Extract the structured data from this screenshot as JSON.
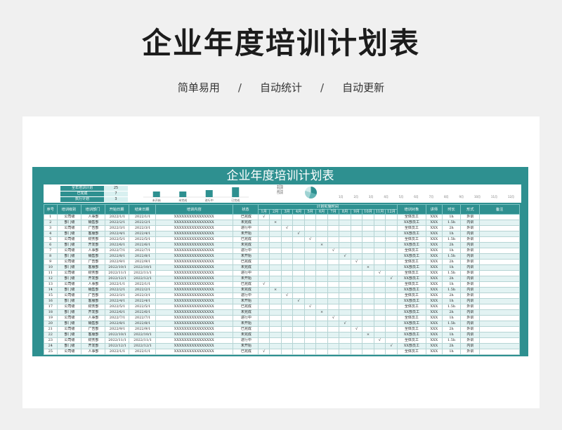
{
  "page": {
    "title": "企业年度培训计划表",
    "taglines": [
      "简单易用",
      "自动统计",
      "自动更新"
    ],
    "separator": "/"
  },
  "sheet": {
    "title": "企业年度培训计划表",
    "stats": [
      {
        "label": "全年培训计划",
        "value": "25"
      },
      {
        "label": "已完成",
        "value": "7"
      },
      {
        "label": "执行计划",
        "value": "3"
      }
    ],
    "mini_chart": {
      "categories": [
        "未开始",
        "未完成",
        "进行中",
        "已完成"
      ],
      "values": [
        4,
        4,
        5,
        7
      ]
    },
    "mini_pie_legend": [
      "未开始",
      "未完成",
      "进行中",
      "已完成"
    ],
    "mini_months": [
      "1月",
      "2月",
      "3月",
      "4月",
      "5月",
      "6月",
      "7月",
      "8月",
      "9月",
      "10月",
      "11月",
      "12月"
    ]
  },
  "table": {
    "headers": {
      "no": "序号",
      "level": "培训级别",
      "dept": "培训部门",
      "plan_date": "开始日期",
      "end_date": "结束日期",
      "content": "培训内容",
      "status": "状态",
      "plan_group": "计划实施时间",
      "target": "培训对象",
      "lecturer": "讲师",
      "hours": "时长",
      "mode": "形式",
      "note": "备注"
    },
    "months": [
      "1月",
      "2月",
      "3月",
      "4月",
      "5月",
      "6月",
      "7月",
      "8月",
      "9月",
      "10月",
      "11月",
      "12月"
    ],
    "rows": [
      {
        "no": "1",
        "level": "公司级",
        "dept": "人事部",
        "start": "2022/1/1",
        "end": "2022/1/1",
        "content": "XXXXXXXXXXXXXXXX",
        "status": "已完成",
        "month": 1,
        "mark": "√",
        "target": "全体员工",
        "lecturer": "XXX",
        "hours": "1h",
        "mode": "外训",
        "note": ""
      },
      {
        "no": "2",
        "level": "部门级",
        "dept": "销售部",
        "start": "2022/2/1",
        "end": "2022/2/1",
        "content": "XXXXXXXXXXXXXXXX",
        "status": "未完成",
        "month": 2,
        "mark": "×",
        "target": "XX部员工",
        "lecturer": "XXX",
        "hours": "1.5h",
        "mode": "内训",
        "note": ""
      },
      {
        "no": "3",
        "level": "公司级",
        "dept": "广告部",
        "start": "2022/3/1",
        "end": "2022/3/1",
        "content": "XXXXXXXXXXXXXXXX",
        "status": "进行中",
        "month": 3,
        "mark": "√",
        "target": "全体员工",
        "lecturer": "XXX",
        "hours": "2h",
        "mode": "外训",
        "note": ""
      },
      {
        "no": "4",
        "level": "部门级",
        "dept": "客服部",
        "start": "2022/4/1",
        "end": "2022/4/1",
        "content": "XXXXXXXXXXXXXXXX",
        "status": "未开始",
        "month": 4,
        "mark": "√",
        "target": "XX部员工",
        "lecturer": "XXX",
        "hours": "1h",
        "mode": "内训",
        "note": ""
      },
      {
        "no": "5",
        "level": "公司级",
        "dept": "财务部",
        "start": "2022/5/1",
        "end": "2022/5/1",
        "content": "XXXXXXXXXXXXXXXX",
        "status": "已完成",
        "month": 5,
        "mark": "√",
        "target": "全体员工",
        "lecturer": "XXX",
        "hours": "1.5h",
        "mode": "外训",
        "note": ""
      },
      {
        "no": "6",
        "level": "部门级",
        "dept": "开发部",
        "start": "2022/6/1",
        "end": "2022/6/1",
        "content": "XXXXXXXXXXXXXXXX",
        "status": "未完成",
        "month": 6,
        "mark": "×",
        "target": "XX部员工",
        "lecturer": "XXX",
        "hours": "2h",
        "mode": "内训",
        "note": ""
      },
      {
        "no": "7",
        "level": "公司级",
        "dept": "人事部",
        "start": "2022/7/1",
        "end": "2022/7/1",
        "content": "XXXXXXXXXXXXXXXX",
        "status": "进行中",
        "month": 7,
        "mark": "√",
        "target": "全体员工",
        "lecturer": "XXX",
        "hours": "1h",
        "mode": "外训",
        "note": ""
      },
      {
        "no": "8",
        "level": "部门级",
        "dept": "销售部",
        "start": "2022/8/1",
        "end": "2022/8/1",
        "content": "XXXXXXXXXXXXXXXX",
        "status": "未开始",
        "month": 8,
        "mark": "√",
        "target": "XX部员工",
        "lecturer": "XXX",
        "hours": "1.5h",
        "mode": "内训",
        "note": ""
      },
      {
        "no": "9",
        "level": "公司级",
        "dept": "广告部",
        "start": "2022/9/1",
        "end": "2022/9/1",
        "content": "XXXXXXXXXXXXXXXX",
        "status": "已完成",
        "month": 9,
        "mark": "√",
        "target": "全体员工",
        "lecturer": "XXX",
        "hours": "2h",
        "mode": "外训",
        "note": ""
      },
      {
        "no": "10",
        "level": "部门级",
        "dept": "客服部",
        "start": "2022/10/1",
        "end": "2022/10/1",
        "content": "XXXXXXXXXXXXXXXX",
        "status": "未完成",
        "month": 10,
        "mark": "×",
        "target": "XX部员工",
        "lecturer": "XXX",
        "hours": "1h",
        "mode": "内训",
        "note": ""
      },
      {
        "no": "11",
        "level": "公司级",
        "dept": "财务部",
        "start": "2022/11/1",
        "end": "2022/11/1",
        "content": "XXXXXXXXXXXXXXXX",
        "status": "进行中",
        "month": 11,
        "mark": "√",
        "target": "全体员工",
        "lecturer": "XXX",
        "hours": "1.5h",
        "mode": "外训",
        "note": ""
      },
      {
        "no": "12",
        "level": "部门级",
        "dept": "开发部",
        "start": "2022/12/1",
        "end": "2022/12/1",
        "content": "XXXXXXXXXXXXXXXX",
        "status": "未开始",
        "month": 12,
        "mark": "√",
        "target": "XX部员工",
        "lecturer": "XXX",
        "hours": "2h",
        "mode": "内训",
        "note": ""
      },
      {
        "no": "13",
        "level": "公司级",
        "dept": "人事部",
        "start": "2022/1/1",
        "end": "2022/1/1",
        "content": "XXXXXXXXXXXXXXXX",
        "status": "已完成",
        "month": 1,
        "mark": "√",
        "target": "全体员工",
        "lecturer": "XXX",
        "hours": "1h",
        "mode": "外训",
        "note": ""
      },
      {
        "no": "14",
        "level": "部门级",
        "dept": "销售部",
        "start": "2022/2/1",
        "end": "2022/2/1",
        "content": "XXXXXXXXXXXXXXXX",
        "status": "未完成",
        "month": 2,
        "mark": "×",
        "target": "XX部员工",
        "lecturer": "XXX",
        "hours": "1.5h",
        "mode": "内训",
        "note": ""
      },
      {
        "no": "15",
        "level": "公司级",
        "dept": "广告部",
        "start": "2022/3/1",
        "end": "2022/3/1",
        "content": "XXXXXXXXXXXXXXXX",
        "status": "进行中",
        "month": 3,
        "mark": "√",
        "target": "全体员工",
        "lecturer": "XXX",
        "hours": "2h",
        "mode": "外训",
        "note": ""
      },
      {
        "no": "16",
        "level": "部门级",
        "dept": "客服部",
        "start": "2022/4/1",
        "end": "2022/4/1",
        "content": "XXXXXXXXXXXXXXXX",
        "status": "未开始",
        "month": 4,
        "mark": "√",
        "target": "XX部员工",
        "lecturer": "XXX",
        "hours": "1h",
        "mode": "内训",
        "note": ""
      },
      {
        "no": "17",
        "level": "公司级",
        "dept": "财务部",
        "start": "2022/5/1",
        "end": "2022/5/1",
        "content": "XXXXXXXXXXXXXXXX",
        "status": "已完成",
        "month": 5,
        "mark": "√",
        "target": "全体员工",
        "lecturer": "XXX",
        "hours": "1.5h",
        "mode": "外训",
        "note": ""
      },
      {
        "no": "18",
        "level": "部门级",
        "dept": "开发部",
        "start": "2022/6/1",
        "end": "2022/6/1",
        "content": "XXXXXXXXXXXXXXXX",
        "status": "未完成",
        "month": 6,
        "mark": "×",
        "target": "XX部员工",
        "lecturer": "XXX",
        "hours": "2h",
        "mode": "内训",
        "note": ""
      },
      {
        "no": "19",
        "level": "公司级",
        "dept": "人事部",
        "start": "2022/7/1",
        "end": "2022/7/1",
        "content": "XXXXXXXXXXXXXXXX",
        "status": "进行中",
        "month": 7,
        "mark": "√",
        "target": "全体员工",
        "lecturer": "XXX",
        "hours": "1h",
        "mode": "外训",
        "note": ""
      },
      {
        "no": "20",
        "level": "部门级",
        "dept": "销售部",
        "start": "2022/8/1",
        "end": "2022/8/1",
        "content": "XXXXXXXXXXXXXXXX",
        "status": "未开始",
        "month": 8,
        "mark": "√",
        "target": "XX部员工",
        "lecturer": "XXX",
        "hours": "1.5h",
        "mode": "内训",
        "note": ""
      },
      {
        "no": "21",
        "level": "公司级",
        "dept": "广告部",
        "start": "2022/9/1",
        "end": "2022/9/1",
        "content": "XXXXXXXXXXXXXXXX",
        "status": "已完成",
        "month": 9,
        "mark": "√",
        "target": "全体员工",
        "lecturer": "XXX",
        "hours": "2h",
        "mode": "外训",
        "note": ""
      },
      {
        "no": "22",
        "level": "部门级",
        "dept": "客服部",
        "start": "2022/10/1",
        "end": "2022/10/1",
        "content": "XXXXXXXXXXXXXXXX",
        "status": "未完成",
        "month": 10,
        "mark": "×",
        "target": "XX部员工",
        "lecturer": "XXX",
        "hours": "1h",
        "mode": "内训",
        "note": ""
      },
      {
        "no": "23",
        "level": "公司级",
        "dept": "财务部",
        "start": "2022/11/1",
        "end": "2022/11/1",
        "content": "XXXXXXXXXXXXXXXX",
        "status": "进行中",
        "month": 11,
        "mark": "√",
        "target": "全体员工",
        "lecturer": "XXX",
        "hours": "1.5h",
        "mode": "外训",
        "note": ""
      },
      {
        "no": "24",
        "level": "部门级",
        "dept": "开发部",
        "start": "2022/12/1",
        "end": "2022/12/1",
        "content": "XXXXXXXXXXXXXXXX",
        "status": "未开始",
        "month": 12,
        "mark": "√",
        "target": "XX部员工",
        "lecturer": "XXX",
        "hours": "2h",
        "mode": "内训",
        "note": ""
      },
      {
        "no": "25",
        "level": "公司级",
        "dept": "人事部",
        "start": "2022/1/1",
        "end": "2022/1/1",
        "content": "XXXXXXXXXXXXXXXX",
        "status": "已完成",
        "month": 1,
        "mark": "√",
        "target": "全体员工",
        "lecturer": "XXX",
        "hours": "1h",
        "mode": "外训",
        "note": ""
      }
    ]
  }
}
